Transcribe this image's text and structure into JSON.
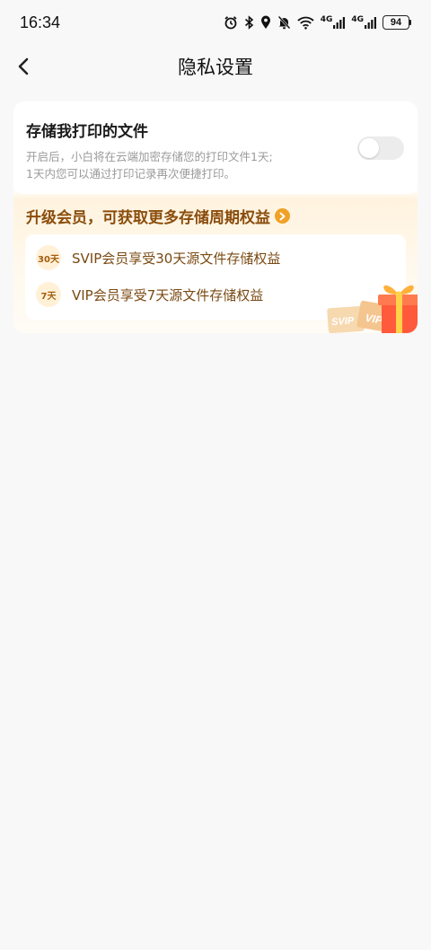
{
  "status_bar": {
    "time": "16:34",
    "network_tag_1": "4G",
    "network_tag_2": "4G",
    "battery": "94",
    "icons": [
      "alarm-icon",
      "bluetooth-icon",
      "location-icon",
      "mute-icon",
      "wifi-icon",
      "signal-icon",
      "battery-icon"
    ]
  },
  "nav": {
    "title": "隐私设置",
    "back_icon": "back-arrow-icon"
  },
  "setting": {
    "title": "存储我打印的文件",
    "description_line1": "开启后，小白将在云端加密存储您的打印文件1天;",
    "description_line2": "1天内您可以通过打印记录再次便捷打印。",
    "toggle_on": false
  },
  "upgrade": {
    "text": "升级会员，可获取更多存储周期权益",
    "arrow_icon": "chevron-right-icon"
  },
  "benefits": [
    {
      "badge": "30天",
      "text": "SVIP会员享受30天源文件存储权益"
    },
    {
      "badge": "7天",
      "text": "VIP会员享受7天源文件存储权益"
    }
  ],
  "illustration": {
    "card_labels": [
      "SVIP",
      "VIP"
    ],
    "icon": "gift-box-icon"
  },
  "colors": {
    "background": "#f8f8f8",
    "accent_orange": "#f0a228",
    "upgrade_brown": "#8a4d0c",
    "benefit_text": "#7a4a12"
  }
}
